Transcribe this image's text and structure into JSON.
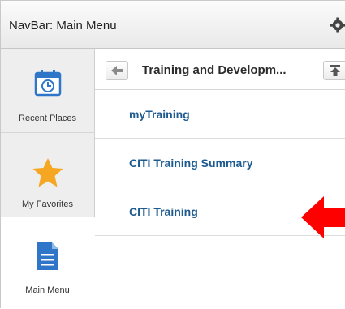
{
  "navbar": {
    "title": "NavBar: Main Menu",
    "settings_icon": "gear-icon"
  },
  "rail": {
    "items": [
      {
        "label": "Recent Places",
        "icon": "calendar-clock-icon",
        "active": false
      },
      {
        "label": "My Favorites",
        "icon": "star-icon",
        "active": false
      },
      {
        "label": "Main Menu",
        "icon": "document-icon",
        "active": true
      }
    ]
  },
  "panel": {
    "title": "Training and Developm...",
    "back_icon": "back-arrow-icon",
    "top_icon": "scroll-top-icon",
    "items": [
      {
        "label": "myTraining"
      },
      {
        "label": "CITI Training Summary"
      },
      {
        "label": "CITI Training"
      }
    ]
  },
  "colors": {
    "link": "#1c5a8f",
    "accent_arrow": "#ff0000",
    "favorites_star": "#f5a623",
    "main_menu_icon": "#2f76c8"
  }
}
